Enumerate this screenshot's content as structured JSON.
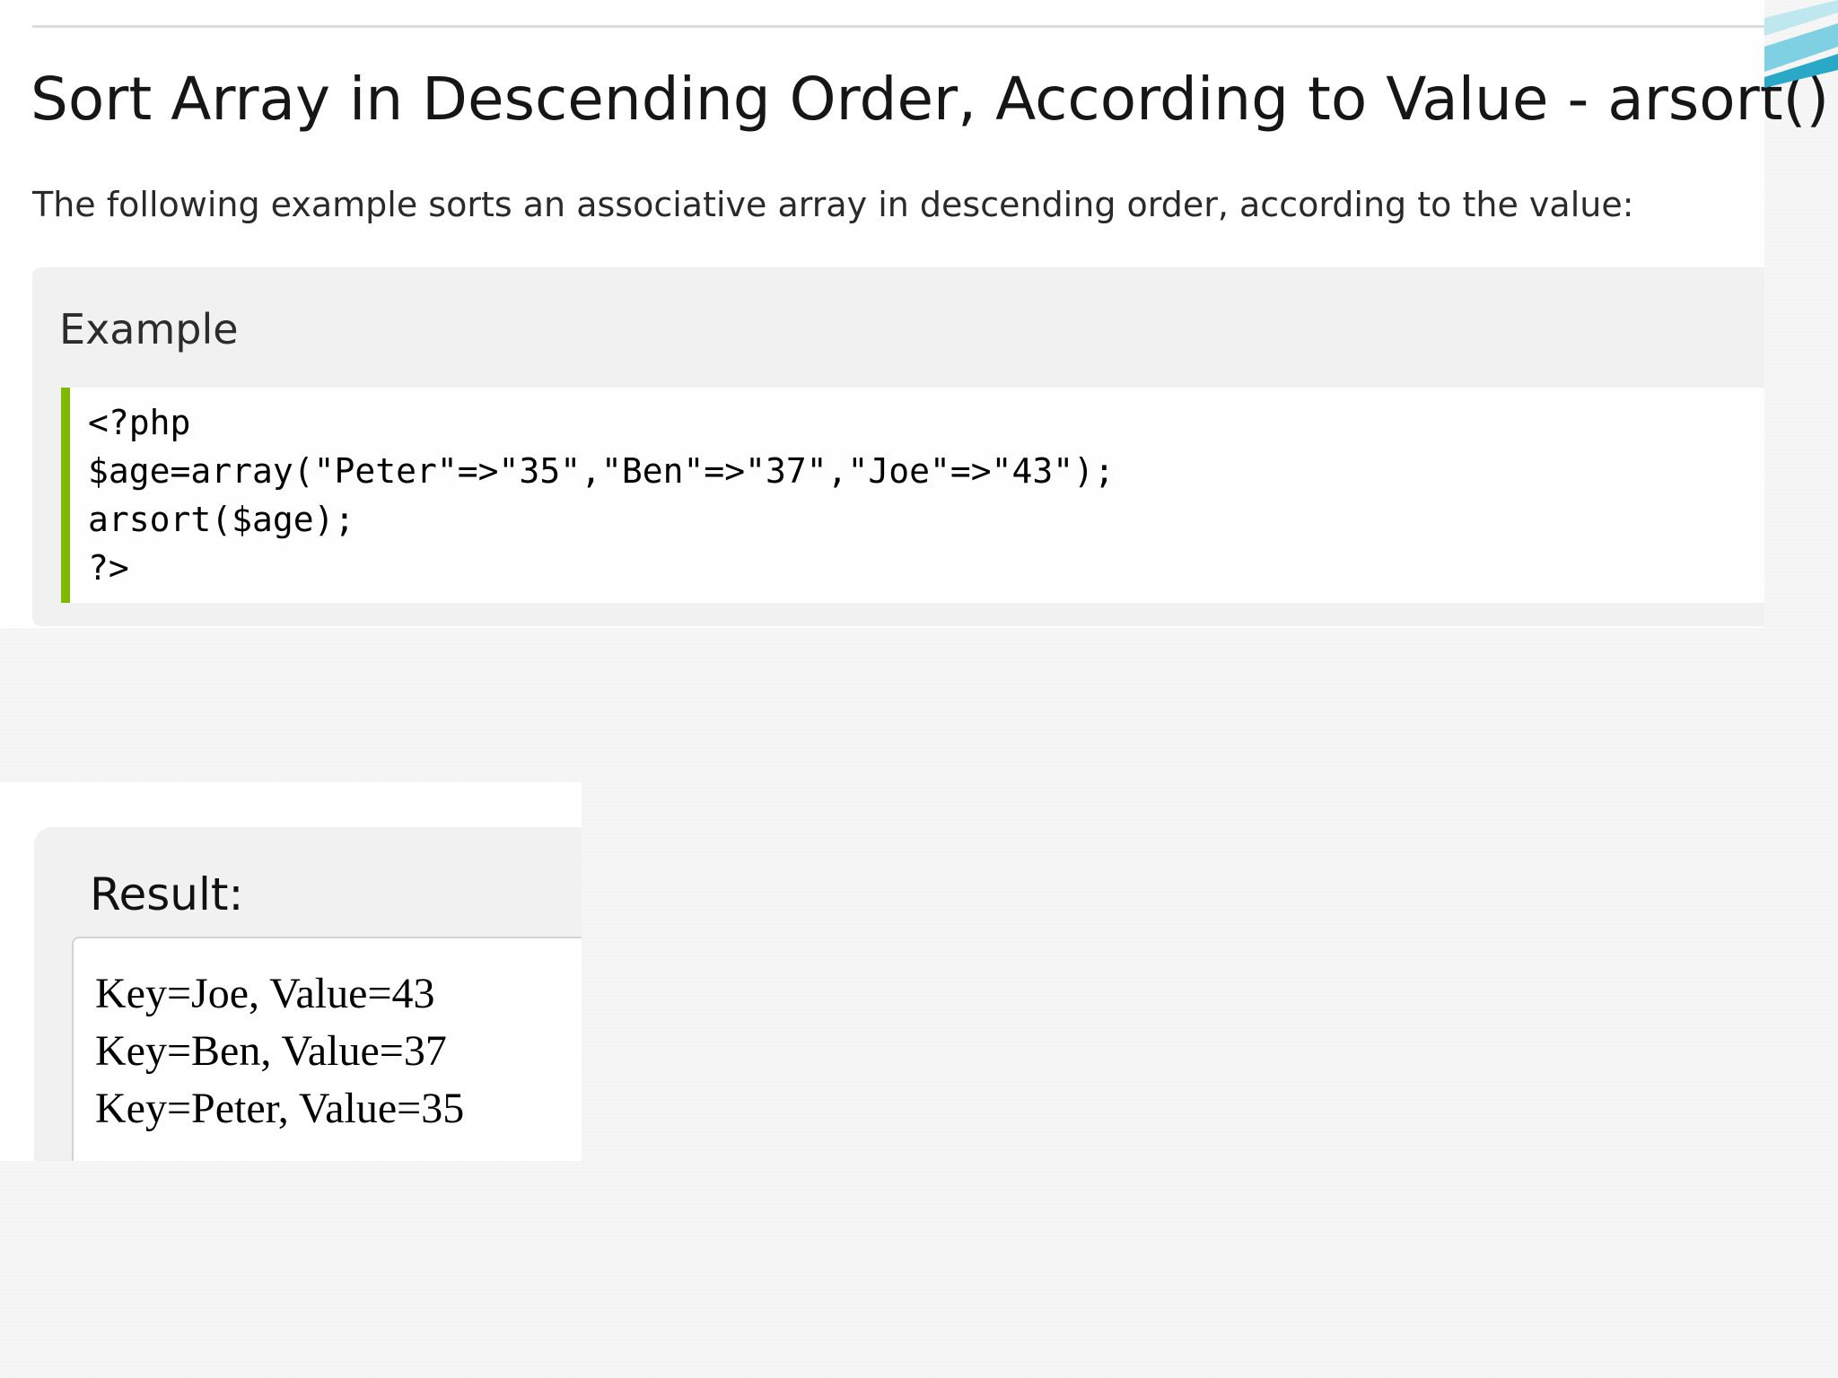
{
  "page": {
    "title": "Sort Array in Descending Order, According to Value - arsort()",
    "intro": "The following example sorts an associative array in descending order, according to the value:"
  },
  "example": {
    "heading": "Example",
    "code_lines": [
      "<?php",
      "$age=array(\"Peter\"=>\"35\",\"Ben\"=>\"37\",\"Joe\"=>\"43\");",
      "arsort($age);",
      "?>"
    ],
    "accent_color": "#7fba00"
  },
  "result": {
    "heading": "Result:",
    "lines": [
      "Key=Joe, Value=43",
      "Key=Ben, Value=37",
      "Key=Peter, Value=35"
    ]
  },
  "decoration": {
    "corner_colors": [
      "#2aa8c8",
      "#7fd0e2",
      "#bfe7f0"
    ]
  }
}
